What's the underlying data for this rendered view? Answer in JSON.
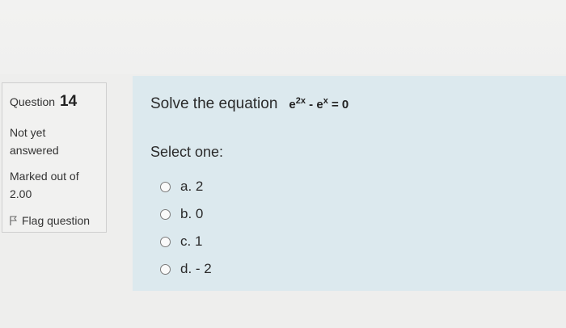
{
  "info": {
    "question_word": "Question",
    "question_number": "14",
    "state": "Not yet answered",
    "grade": "Marked out of 2.00",
    "flag_label": "Flag question",
    "flag_icon": "flag-icon"
  },
  "question": {
    "prompt": "Solve the equation",
    "equation": {
      "base1": "e",
      "exp1": "2x",
      "minus": " - ",
      "base2": "e",
      "exp2": "x",
      "equals": " = 0"
    },
    "select_label": "Select one:"
  },
  "answers": [
    {
      "label": "a. 2"
    },
    {
      "label": "b. 0"
    },
    {
      "label": "c. 1"
    },
    {
      "label": "d. - 2"
    }
  ],
  "colors": {
    "panel_background": "#dce9ee",
    "info_background": "#f1f1f0",
    "page_background": "#eeeeed"
  }
}
